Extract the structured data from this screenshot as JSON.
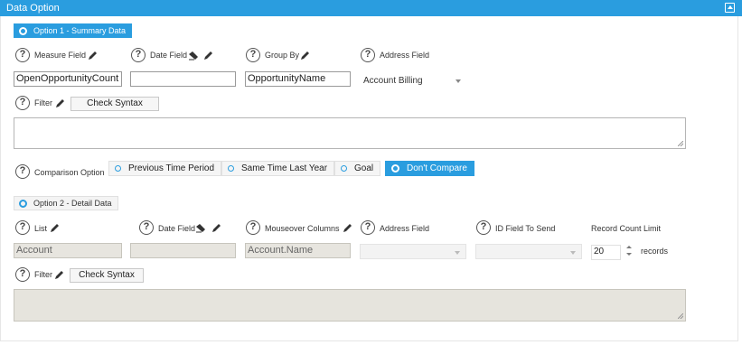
{
  "header": {
    "title": "Data Option"
  },
  "option1": {
    "label": "Option 1 - Summary Data",
    "measure_field_label": "Measure Field",
    "date_field_label": "Date Field",
    "group_by_label": "Group By",
    "address_field_label": "Address Field",
    "measure_field_value": "OpenOpportunityCount",
    "date_field_value": "",
    "group_by_value": "OpportunityName",
    "address_field_value": "Account Billing",
    "filter_label": "Filter",
    "check_syntax_label": "Check Syntax",
    "filter_value": "",
    "comparison_label": "Comparison Option",
    "comparison_options": [
      "Previous Time Period",
      "Same Time Last Year",
      "Goal",
      "Don't Compare"
    ],
    "comparison_selected": "Don't Compare"
  },
  "option2": {
    "label": "Option 2 - Detail Data",
    "list_label": "List",
    "date_field_label": "Date Field",
    "mouseover_label": "Mouseover Columns",
    "address_field_label": "Address Field",
    "id_field_label": "ID Field To Send",
    "record_count_label": "Record Count Limit",
    "list_value": "Account",
    "date_field_value": "",
    "mouseover_value": "Account.Name",
    "address_field_value": "",
    "id_field_value": "",
    "record_count_value": "20",
    "records_unit": "records",
    "filter_label": "Filter",
    "check_syntax_label": "Check Syntax",
    "filter_value": ""
  },
  "icons": {
    "help": "?",
    "edit": "pencil-icon",
    "clear": "eraser-icon",
    "collapse": "collapse-icon"
  },
  "colors": {
    "accent": "#2a9ddf",
    "disabled": "#e7e5df"
  }
}
